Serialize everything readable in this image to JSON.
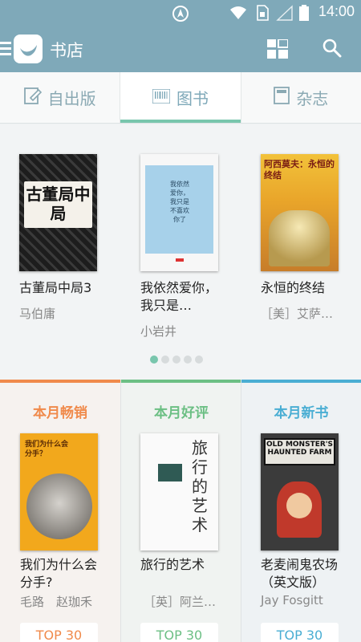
{
  "status_bar": {
    "time": "14:00"
  },
  "app_bar": {
    "title": "书店"
  },
  "tabs": [
    {
      "label": "自出版",
      "active": false
    },
    {
      "label": "图书",
      "active": true
    },
    {
      "label": "杂志",
      "active": false
    }
  ],
  "carousel": {
    "books": [
      {
        "title": "古董局中局3",
        "author": "马伯庸",
        "cover_text": "古董局中局"
      },
      {
        "title": "我依然爱你，我只是…",
        "author": "小岩井",
        "cover_text": "我依然爱你，我只是不喜欢你了"
      },
      {
        "title": "永恒的终结",
        "author": "［美］艾萨…",
        "cover_text": "阿西莫夫：永恒的终结"
      }
    ],
    "page_count": 5,
    "active_page": 1
  },
  "sections": [
    {
      "heading": "本月畅销",
      "color": "#f08a4b",
      "book_title": "我们为什么会分手?",
      "author": "毛路　赵珈禾",
      "pill": "TOP 30",
      "cover_text": "我们为什么会分手？"
    },
    {
      "heading": "本月好评",
      "color": "#6cbf84",
      "book_title": "旅行的艺术",
      "author": "［英］阿兰…",
      "pill": "TOP 30",
      "cover_text": "旅行的艺术"
    },
    {
      "heading": "本月新书",
      "color": "#4aaed3",
      "book_title": "老麦闹鬼农场（英文版）",
      "author": "Jay Fosgitt",
      "pill": "TOP 30",
      "cover_text": "OLD MONSTER'S HAUNTED FARM"
    }
  ]
}
